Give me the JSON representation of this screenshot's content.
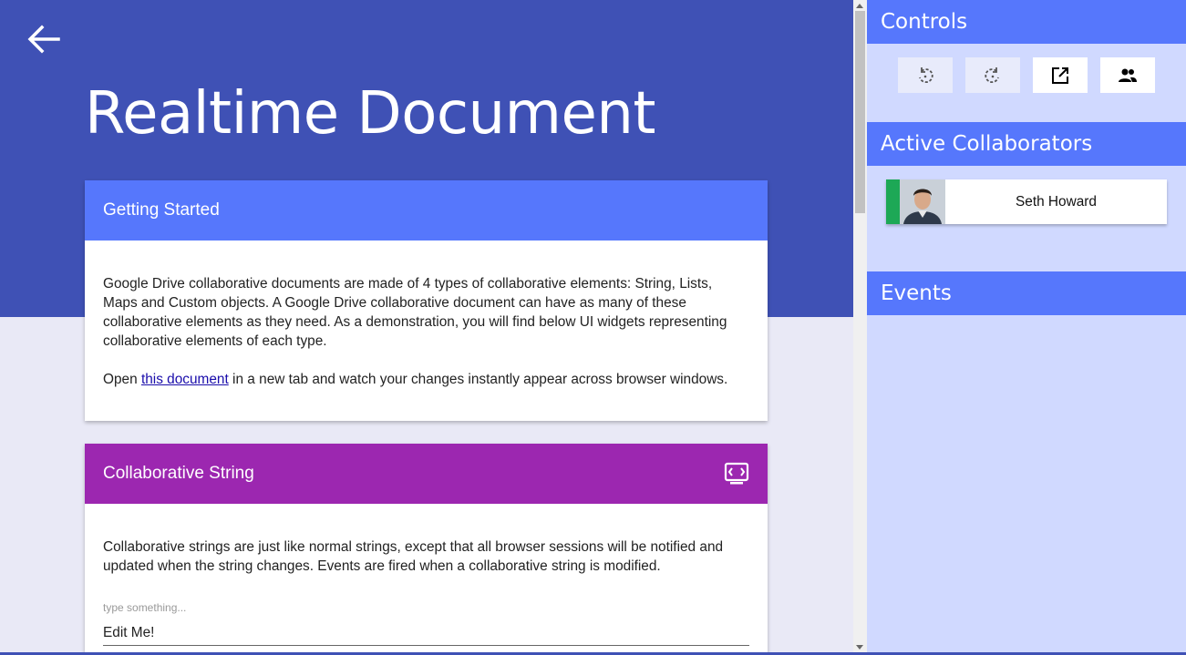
{
  "main": {
    "title": "Realtime Document",
    "back_icon": "arrow-left-icon"
  },
  "getting_started": {
    "title": "Getting Started",
    "paragraph1": "Google Drive collaborative documents are made of 4 types of collaborative elements: String, Lists, Maps and Custom objects. A Google Drive collaborative document can have as many of these collaborative elements as they need. As a demonstration, you will find below UI widgets representing collaborative elements of each type.",
    "paragraph2_prefix": "Open ",
    "paragraph2_link": "this document",
    "paragraph2_suffix": " in a new tab and watch your changes instantly appear across browser windows."
  },
  "collab_string": {
    "title": "Collaborative String",
    "header_icon": "code-screen-icon",
    "description": "Collaborative strings are just like normal strings, except that all browser sessions will be notified and updated when the string changes. Events are fired when a collaborative string is modified.",
    "input_label": "type something...",
    "input_value": "Edit Me!"
  },
  "sidebar": {
    "controls_title": "Controls",
    "controls": [
      {
        "name": "undo-icon",
        "enabled": false
      },
      {
        "name": "redo-icon",
        "enabled": false
      },
      {
        "name": "open-in-new-icon",
        "enabled": true
      },
      {
        "name": "share-people-icon",
        "enabled": true
      }
    ],
    "collaborators_title": "Active Collaborators",
    "collaborators": [
      {
        "name": "Seth Howard",
        "color": "#1da856"
      }
    ],
    "events_title": "Events"
  },
  "colors": {
    "primary": "#3f51b5",
    "accent": "#5677fc",
    "purple": "#9c27b0",
    "sidebar_bg": "#d0d9ff"
  }
}
